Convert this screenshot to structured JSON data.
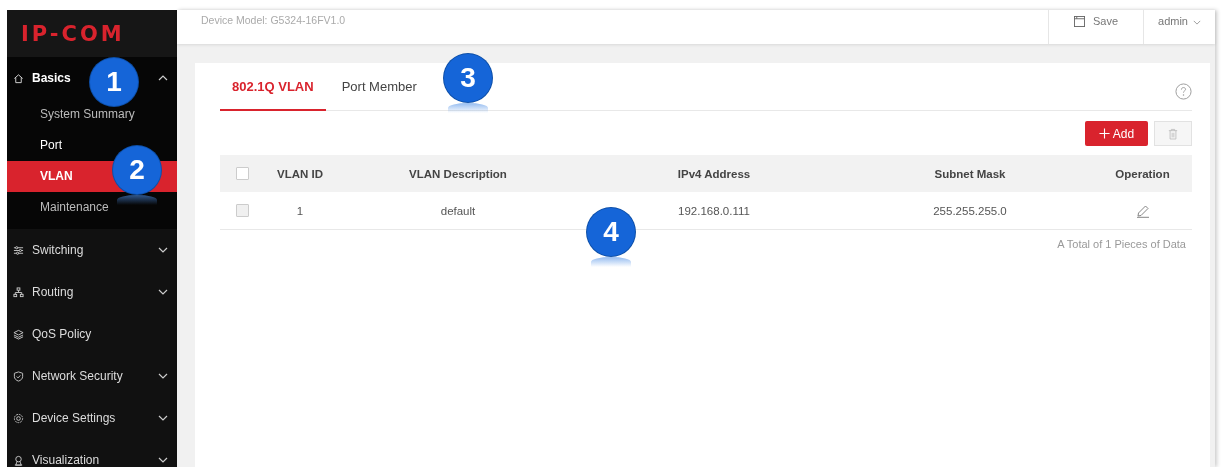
{
  "logo": "IP-COM",
  "sidebar": {
    "items": [
      {
        "label": "Basics",
        "kind": "group",
        "expanded": true,
        "children": [
          {
            "label": "System Summary",
            "selected": false
          },
          {
            "label": "Port",
            "selected": false
          },
          {
            "label": "VLAN",
            "selected": true
          },
          {
            "label": "Maintenance",
            "selected": false
          }
        ]
      },
      {
        "label": "Switching",
        "kind": "group",
        "expanded": false
      },
      {
        "label": "Routing",
        "kind": "group",
        "expanded": false
      },
      {
        "label": "QoS Policy",
        "kind": "link"
      },
      {
        "label": "Network Security",
        "kind": "group",
        "expanded": false
      },
      {
        "label": "Device Settings",
        "kind": "group",
        "expanded": false
      },
      {
        "label": "Visualization",
        "kind": "group",
        "expanded": false
      }
    ]
  },
  "topbar": {
    "device_model": "Device Model: G5324-16FV1.0",
    "save": "Save",
    "user": "admin"
  },
  "tabs": [
    {
      "label": "802.1Q VLAN",
      "selected": true
    },
    {
      "label": "Port Member",
      "selected": false
    }
  ],
  "toolbar": {
    "add": "Add"
  },
  "table": {
    "columns": [
      "VLAN ID",
      "VLAN Description",
      "IPv4 Address",
      "Subnet Mask",
      "Operation"
    ],
    "header_checked": false,
    "rows": [
      {
        "checked": false,
        "cells": [
          "1",
          "default",
          "192.168.0.111",
          "255.255.255.0"
        ]
      }
    ]
  },
  "footer": "A Total of 1 Pieces of Data",
  "callouts": [
    "1",
    "2",
    "3",
    "4"
  ]
}
